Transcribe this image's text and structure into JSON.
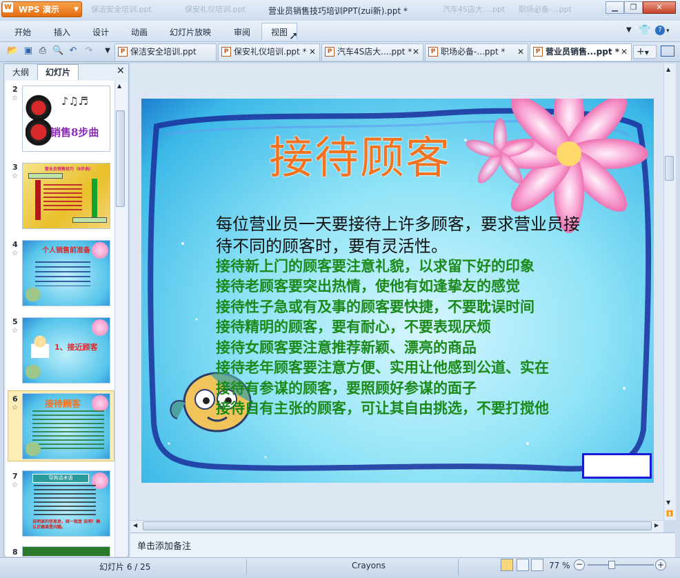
{
  "app": {
    "logo_text": "WPS 演示",
    "window_title": "营业员销售技巧培训PPT(zui新).ppt *"
  },
  "ghost_tabs": [
    "保洁安全培训.ppt",
    "保安礼仪培训.ppt",
    "汽车4S店大....ppt",
    "职场必备-...ppt"
  ],
  "menu": [
    "开始",
    "插入",
    "设计",
    "动画",
    "幻灯片放映",
    "审阅",
    "视图"
  ],
  "doc_tabs": [
    {
      "label": "保洁安全培训.ppt"
    },
    {
      "label": "保安礼仪培训.ppt *"
    },
    {
      "label": "汽车4S店大....ppt *"
    },
    {
      "label": "职场必备-...ppt *"
    },
    {
      "label": "营业员销售...ppt *",
      "active": true
    }
  ],
  "panel": {
    "tab_outline": "大纲",
    "tab_slides": "幻灯片"
  },
  "thumbnails": [
    {
      "num": "2",
      "title": "销售8步曲"
    },
    {
      "num": "3",
      "title": "营业员销售技巧（8步曲）"
    },
    {
      "num": "4",
      "title": "个人销售前准备"
    },
    {
      "num": "5",
      "title": "1、接近顾客"
    },
    {
      "num": "6",
      "title": "接待顾客",
      "selected": true
    },
    {
      "num": "7",
      "title": "导购话术语"
    },
    {
      "num": "8",
      "title": ""
    }
  ],
  "thumb7_bottom": "说明谁的信息是，统一就是 说明！确认正确谁是问题。",
  "slide": {
    "title": "接待顾客",
    "intro_lines": [
      "每位营业员一天要接待上许多顾客，要求营业员接",
      "待不同的顾客时，要有灵活性。"
    ],
    "green_lines": [
      "接待新上门的顾客要注意礼貌，以求留下好的印象",
      "接待老顾客要突出热情，使他有如逢挚友的感觉",
      "接待性子急或有及事的顾客要快捷，不要耽误时间",
      "接待精明的顾客，要有耐心，不要表现厌烦",
      "接待女顾客要注意推荐新颖、漂亮的商品",
      "接待老年顾客要注意方便、实用让他感到公道、实在",
      "接待有参谋的顾客，要照顾好参谋的面子",
      "接待自有主张的顾客，可让其自由挑选，不要打搅他"
    ]
  },
  "notes_placeholder": "单击添加备注",
  "status": {
    "slide_info": "幻灯片 6 / 25",
    "theme": "Crayons",
    "zoom": "77 %"
  },
  "colors": {
    "title_orange": "#f37320",
    "body_green": "#1b8a1b",
    "accent_orange": "#e46d10"
  }
}
